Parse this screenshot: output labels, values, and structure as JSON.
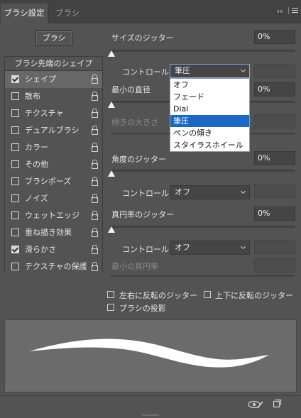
{
  "tabs": [
    {
      "label": "ブラシ設定"
    },
    {
      "label": "ブラシ"
    }
  ],
  "tab_overflow_glyph": "››",
  "brush_button_label": "ブラシ",
  "list": {
    "header": "ブラシ先端のシェイプ",
    "items": [
      {
        "label": "シェイプ",
        "checked": true,
        "selected": true
      },
      {
        "label": "散布",
        "checked": false
      },
      {
        "label": "テクスチャ",
        "checked": false
      },
      {
        "label": "デュアルブラシ",
        "checked": false
      },
      {
        "label": "カラー",
        "checked": false
      },
      {
        "label": "その他",
        "checked": false
      },
      {
        "label": "ブラシポーズ",
        "checked": false
      },
      {
        "label": "ノイズ",
        "checked": false
      },
      {
        "label": "ウェットエッジ",
        "checked": false
      },
      {
        "label": "重ね描き効果",
        "checked": false
      },
      {
        "label": "滑らかさ",
        "checked": true
      },
      {
        "label": "テクスチャの保護",
        "checked": false
      }
    ]
  },
  "size_jitter": {
    "label": "サイズのジッター",
    "value": "0%"
  },
  "control1": {
    "label": "コントロール：",
    "value": "筆圧"
  },
  "min_diameter": {
    "label": "最小の直径",
    "value": "0%"
  },
  "tilt_scale": {
    "label": "傾きの大きさ"
  },
  "dropdown_options": [
    "オフ",
    "フェード",
    "Dial",
    "筆圧",
    "ペンの傾き",
    "スタイラスホイール"
  ],
  "dropdown_selected_index": 3,
  "angle_jitter": {
    "label": "角度のジッター",
    "value": "0%"
  },
  "control2": {
    "label": "コントロール：",
    "value": "オフ"
  },
  "roundness_jitter": {
    "label": "真円率のジッター",
    "value": "0%"
  },
  "control3": {
    "label": "コントロール：",
    "value": "オフ"
  },
  "min_roundness": {
    "label": "最小の真円率"
  },
  "flip_x": {
    "label": "左右に反転のジッター",
    "checked": false
  },
  "flip_y": {
    "label": "上下に反転のジッター",
    "checked": false
  },
  "brush_projection": {
    "label": "ブラシの投影",
    "checked": false
  },
  "icons": {
    "toggle_preview": "eye-brush-icon",
    "new_preset": "new-preset-icon",
    "panel_menu": "hamburger-menu-icon",
    "lock": "lock-icon"
  }
}
